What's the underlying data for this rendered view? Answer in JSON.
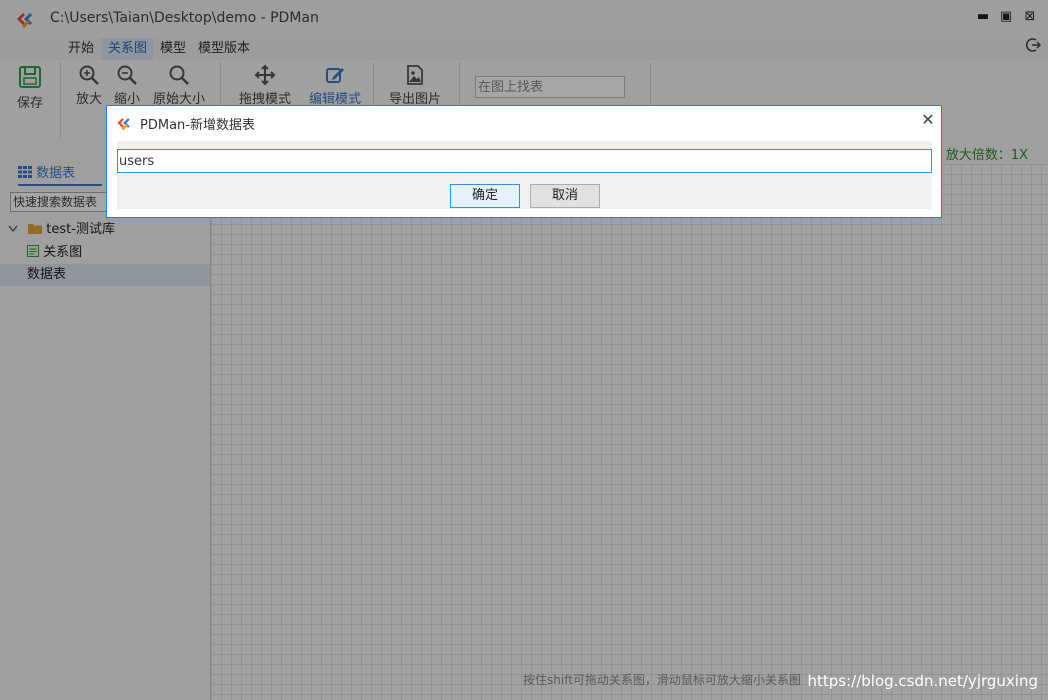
{
  "window": {
    "title": "C:\\Users\\Taian\\Desktop\\demo - PDMan",
    "minimize_glyph": "▬",
    "maximize_glyph": "▣",
    "close_glyph": "⊠"
  },
  "menu": {
    "tabs": [
      {
        "label": "开始",
        "active": false
      },
      {
        "label": "关系图",
        "active": true
      },
      {
        "label": "模型",
        "active": false
      },
      {
        "label": "模型版本",
        "active": false
      }
    ]
  },
  "toolbar": {
    "save": "保存",
    "zoom_in": "放大",
    "zoom_out": "缩小",
    "original_size": "原始大小",
    "drag_mode": "拖拽模式",
    "edit_mode": "编辑模式",
    "export_image": "导出图片",
    "find_placeholder": "在图上找表"
  },
  "sidebar": {
    "tab_label": "数据表",
    "search_placeholder": "快速搜索数据表",
    "tree": {
      "root": "test-测试库",
      "items": [
        "关系图",
        "数据表"
      ]
    }
  },
  "canvas": {
    "zoom_label": "放大倍数：1X",
    "hint": "按住shift可拖动关系图，滑动鼠标可放大缩小关系图",
    "watermark": "https://blog.csdn.net/yjrguxing"
  },
  "dialog": {
    "title": "PDMan-新增数据表",
    "close_glyph": "✕",
    "input_value": "users",
    "ok_label": "确定",
    "cancel_label": "取消"
  },
  "colors": {
    "accent": "#3c78c3",
    "dialog_border": "#2d7bd1",
    "zoom_text": "#2d8a2d",
    "save_icon": "#2e9e4f"
  }
}
